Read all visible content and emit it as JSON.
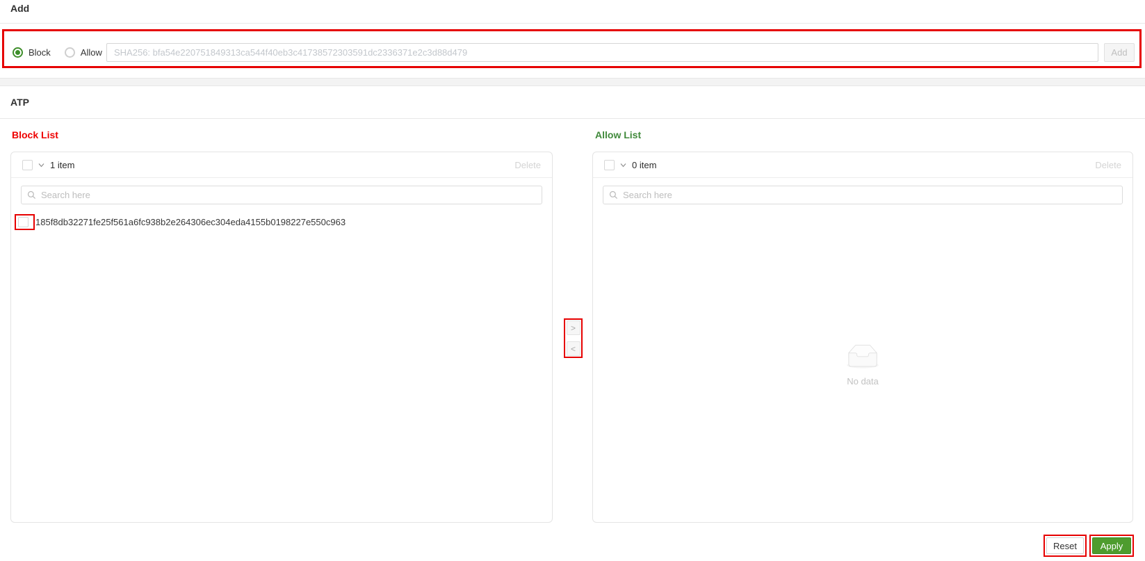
{
  "colors": {
    "annotation_red": "#e60000",
    "block_list_title_red": "#ee0000",
    "allow_list_title_green": "#418a3c",
    "selected_radio_green": "#3e8e2a",
    "apply_button_green": "#4e9c2e"
  },
  "icons": {
    "search_icon": "magnifier",
    "chevron_down_icon": "v",
    "transfer_right_icon": ">",
    "transfer_left_icon": "<",
    "empty_inbox_icon": "empty-tray"
  },
  "add_section": {
    "title": "Add",
    "block_radio_label": "Block",
    "allow_radio_label": "Allow",
    "block_radio_selected": true,
    "allow_radio_selected": false,
    "hash_input_value": "",
    "hash_input_placeholder": "SHA256: bfa54e220751849313ca544f40eb3c41738572303591dc2336371e2c3d88d479",
    "add_button_label": "Add"
  },
  "atp_section": {
    "title": "ATP",
    "block_list": {
      "title": "Block List",
      "item_count_label": "1 item",
      "delete_label": "Delete",
      "search_placeholder": "Search here",
      "search_value": "",
      "items": [
        "185f8db32271fe25f561a6fc938b2e264306ec304eda4155b0198227e550c963"
      ]
    },
    "allow_list": {
      "title": "Allow List",
      "item_count_label": "0 item",
      "delete_label": "Delete",
      "search_placeholder": "Search here",
      "search_value": "",
      "items": [],
      "empty_text": "No data"
    },
    "transfer_buttons": {
      "move_to_allow": ">",
      "move_to_block": "<"
    }
  },
  "footer": {
    "reset_label": "Reset",
    "apply_label": "Apply"
  }
}
